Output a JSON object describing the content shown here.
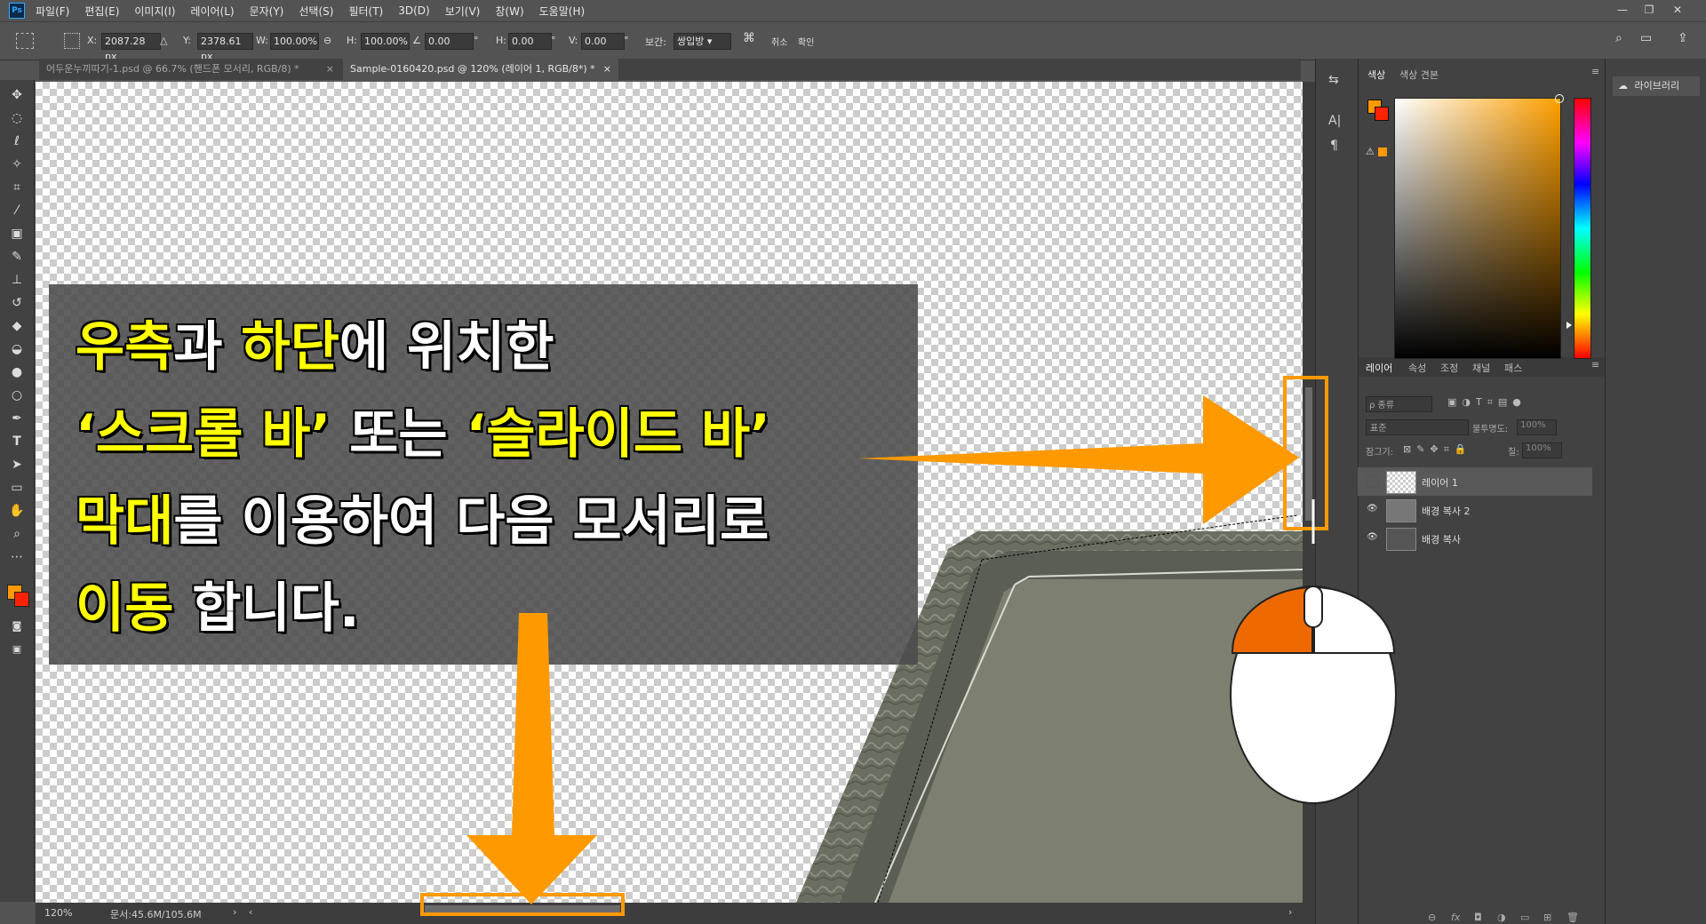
{
  "app_logo": "Ps",
  "menu": [
    "파일(F)",
    "편집(E)",
    "이미지(I)",
    "레이어(L)",
    "문자(Y)",
    "선택(S)",
    "필터(T)",
    "3D(D)",
    "보기(V)",
    "창(W)",
    "도움말(H)"
  ],
  "window_controls": [
    "—",
    "❐",
    "✕"
  ],
  "options": {
    "x_label": "X:",
    "x_value": "2087.28 px",
    "y_label": "Y:",
    "y_value": "2378.61 px",
    "w_label": "W:",
    "w_value": "100.00%",
    "h_label": "H:",
    "h_value": "100.00%",
    "angle_value": "0.00",
    "deg1": "°",
    "hskew_label": "H:",
    "hskew_value": "0.00",
    "deg2": "°",
    "vskew_label": "V:",
    "vskew_value": "0.00",
    "deg3": "°",
    "interp_label": "보간:",
    "interp_value": "쌍입방",
    "cancel_label": "취소",
    "commit_label": "확인"
  },
  "tabs": [
    {
      "label": "어두운누끼따기-1.psd @ 66.7% (핸드폰 모서리, RGB/8) *",
      "close": "×"
    },
    {
      "label": "Sample-0160420.psd @ 120% (레이어 1, RGB/8*) *",
      "close": "×"
    }
  ],
  "status": {
    "zoom": "120%",
    "doc": "문서:45.6M/105.6M",
    "arrow": "›",
    "left": "‹",
    "right": "›"
  },
  "color_panel": {
    "tab1": "색상",
    "tab2": "색상 견본",
    "menu": "≡"
  },
  "libraries": {
    "label": "라이브러리"
  },
  "layers_panel": {
    "tabs": [
      "레이어",
      "속성",
      "조정",
      "채널",
      "패스"
    ],
    "filter_placeholder": "ρ 종류",
    "blend_mode": "표준",
    "opacity_label": "불투명도:",
    "opacity_value": "100%",
    "lock_label": "잠그기:",
    "fill_label": "칠:",
    "fill_value": "100%",
    "layers": [
      {
        "name": "레이어 1",
        "visible": false
      },
      {
        "name": "배경 복사 2",
        "visible": true
      },
      {
        "name": "배경 복사",
        "visible": true
      }
    ],
    "footer_icons": [
      "⊖",
      "fx",
      "◘",
      "◑",
      "▭",
      "⊞",
      "🗑"
    ]
  },
  "overlay": {
    "line1_hl1": "우측",
    "line1_t1": "과 ",
    "line1_hl2": "하단",
    "line1_t2": "에 위치한",
    "line2_hl1": "‘스크롤 바’",
    "line2_t1": " 또는 ",
    "line2_hl2": "‘슬라이드 바’",
    "line3_hl1": "막대",
    "line3_t1": "를 이용하여 다음 모서리로",
    "line4_hl1": "이동",
    "line4_t1": " 합니다."
  },
  "colors": {
    "accent": "#ff9900",
    "foreground": "#ff9900",
    "background": "#ff2200",
    "mouse_left": "#ee6a00"
  }
}
